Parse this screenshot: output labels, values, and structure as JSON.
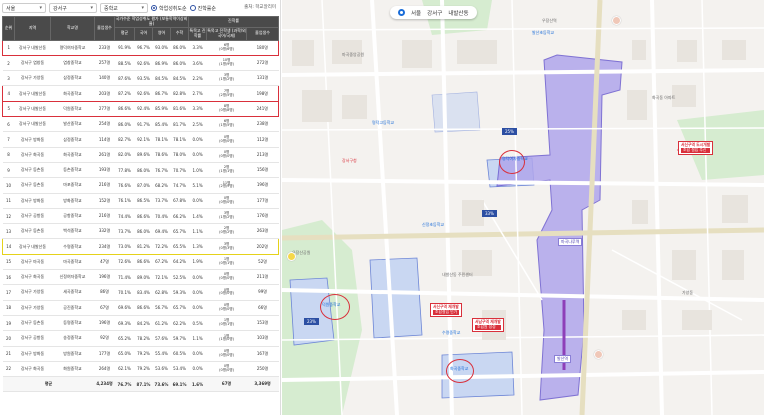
{
  "filters": {
    "region": "서울",
    "district": "강서구",
    "school_type": "중학교",
    "radio_1": "학업성취도순",
    "radio_2": "진학률순",
    "source": "출처: 학교알리미"
  },
  "table": {
    "headers": {
      "rank": "순위",
      "area": "지역",
      "school": "학교명",
      "students": "졸업생수",
      "group_top": "국가수준 학업성취도 평가 (보통학력이상비율)",
      "avg": "평균",
      "korean": "국어",
      "english": "영어",
      "math": "수학",
      "group_adv": "진학률",
      "sci": "특목고 진학률",
      "rate_sub": "특목고 진학생 (과학/외국어/국제)",
      "total": "졸업생수"
    },
    "rows": [
      {
        "rank": "1",
        "area": "강서구 내발산동",
        "school": "명덕여자중학교",
        "students": "233명",
        "avg": "91.9%",
        "kor": "96.7%",
        "eng": "93.0%",
        "math": "86.0%",
        "rate": "3.3%",
        "adv": "6명",
        "adv_sub": "(0명/6명)",
        "total": "180명",
        "hl": "red"
      },
      {
        "rank": "2",
        "area": "강서구 염창동",
        "school": "염창중학교",
        "students": "257명",
        "avg": "88.5%",
        "kor": "92.6%",
        "eng": "86.9%",
        "math": "86.0%",
        "rate": "3.6%",
        "adv": "10명",
        "adv_sub": "(1명/9명)",
        "total": "272명",
        "hl": ""
      },
      {
        "rank": "3",
        "area": "강서구 가양동",
        "school": "삼정중학교",
        "students": "140명",
        "avg": "87.6%",
        "kor": "93.5%",
        "eng": "84.5%",
        "math": "84.5%",
        "rate": "2.2%",
        "adv": "3명",
        "adv_sub": "(1명/2명)",
        "total": "131명",
        "hl": ""
      },
      {
        "rank": "4",
        "area": "강서구 내발산동",
        "school": "화곡중학교",
        "students": "203명",
        "avg": "87.2%",
        "kor": "92.6%",
        "eng": "86.7%",
        "math": "82.8%",
        "rate": "2.7%",
        "adv": "7명",
        "adv_sub": "(2명/5명)",
        "total": "198명",
        "hl": "red"
      },
      {
        "rank": "5",
        "area": "강서구 내발산동",
        "school": "덕원중학교",
        "students": "277명",
        "avg": "86.6%",
        "kor": "92.4%",
        "eng": "85.9%",
        "math": "81.6%",
        "rate": "3.3%",
        "adv": "8명",
        "adv_sub": "(0명/8명)",
        "total": "241명",
        "hl": "red"
      },
      {
        "rank": "6",
        "area": "강서구 내발산동",
        "school": "발산중학교",
        "students": "254명",
        "avg": "86.0%",
        "kor": "91.7%",
        "eng": "85.4%",
        "math": "81.7%",
        "rate": "2.5%",
        "adv": "6명",
        "adv_sub": "(1명/5명)",
        "total": "238명",
        "hl": ""
      },
      {
        "rank": "7",
        "area": "강서구 방화동",
        "school": "삼정중학교",
        "students": "114명",
        "avg": "82.7%",
        "kor": "92.1%",
        "eng": "78.1%",
        "math": "78.1%",
        "rate": "0.0%",
        "adv": "0명",
        "adv_sub": "(0명/0명)",
        "total": "112명",
        "hl": ""
      },
      {
        "rank": "8",
        "area": "강서구 화곡동",
        "school": "화곡중학교",
        "students": "261명",
        "avg": "82.0%",
        "kor": "89.6%",
        "eng": "78.6%",
        "math": "78.0%",
        "rate": "0.0%",
        "adv": "0명",
        "adv_sub": "(0명/0명)",
        "total": "213명",
        "hl": ""
      },
      {
        "rank": "9",
        "area": "강서구 등촌동",
        "school": "등촌중학교",
        "students": "193명",
        "avg": "77.8%",
        "kor": "86.0%",
        "eng": "76.7%",
        "math": "70.7%",
        "rate": "1.0%",
        "adv": "2명",
        "adv_sub": "(1명/1명)",
        "total": "156명",
        "hl": ""
      },
      {
        "rank": "10",
        "area": "강서구 등촌동",
        "school": "마포중학교",
        "students": "216명",
        "avg": "76.6%",
        "kor": "87.0%",
        "eng": "68.2%",
        "math": "74.7%",
        "rate": "5.1%",
        "adv": "11명",
        "adv_sub": "(2명/9명)",
        "total": "196명",
        "hl": ""
      },
      {
        "rank": "11",
        "area": "강서구 방화동",
        "school": "방화중학교",
        "students": "152명",
        "avg": "76.1%",
        "kor": "86.5%",
        "eng": "73.7%",
        "math": "67.8%",
        "rate": "0.0%",
        "adv": "0명",
        "adv_sub": "(0명/0명)",
        "total": "177명",
        "hl": ""
      },
      {
        "rank": "12",
        "area": "강서구 공항동",
        "school": "공항중학교",
        "students": "216명",
        "avg": "74.4%",
        "kor": "86.6%",
        "eng": "70.4%",
        "math": "66.2%",
        "rate": "1.4%",
        "adv": "3명",
        "adv_sub": "(1명/2명)",
        "total": "176명",
        "hl": ""
      },
      {
        "rank": "13",
        "area": "강서구 등촌동",
        "school": "백석중학교",
        "students": "332명",
        "avg": "73.7%",
        "kor": "86.0%",
        "eng": "69.4%",
        "math": "65.7%",
        "rate": "1.1%",
        "adv": "2명",
        "adv_sub": "(0명/2명)",
        "total": "263명",
        "hl": ""
      },
      {
        "rank": "14",
        "area": "강서구 내발산동",
        "school": "수명중학교",
        "students": "234명",
        "avg": "73.0%",
        "kor": "81.2%",
        "eng": "72.2%",
        "math": "65.5%",
        "rate": "1.3%",
        "adv": "3명",
        "adv_sub": "(0명/3명)",
        "total": "202명",
        "hl": "yellow"
      },
      {
        "rank": "15",
        "area": "강서구 마곡동",
        "school": "마곡중학교",
        "students": "47명",
        "avg": "72.6%",
        "kor": "86.6%",
        "eng": "67.2%",
        "math": "64.2%",
        "rate": "1.9%",
        "adv": "1명",
        "adv_sub": "(0명/1명)",
        "total": "52명",
        "hl": ""
      },
      {
        "rank": "16",
        "area": "강서구 화곡동",
        "school": "신정여자중학교",
        "students": "196명",
        "avg": "71.4%",
        "kor": "89.0%",
        "eng": "72.1%",
        "math": "52.5%",
        "rate": "0.0%",
        "adv": "0명",
        "adv_sub": "(0명/0명)",
        "total": "211명",
        "hl": ""
      },
      {
        "rank": "17",
        "area": "강서구 가양동",
        "school": "세곡중학교",
        "students": "86명",
        "avg": "70.1%",
        "kor": "83.4%",
        "eng": "62.8%",
        "math": "59.3%",
        "rate": "0.0%",
        "adv": "0명",
        "adv_sub": "(0명/0명)",
        "total": "99명",
        "hl": ""
      },
      {
        "rank": "18",
        "area": "강서구 가양동",
        "school": "공진중학교",
        "students": "67명",
        "avg": "69.6%",
        "kor": "86.6%",
        "eng": "56.7%",
        "math": "65.7%",
        "rate": "0.0%",
        "adv": "0명",
        "adv_sub": "(0명/0명)",
        "total": "66명",
        "hl": ""
      },
      {
        "rank": "19",
        "area": "강서구 등촌동",
        "school": "등명중학교",
        "students": "196명",
        "avg": "69.3%",
        "kor": "84.2%",
        "eng": "61.2%",
        "math": "62.2%",
        "rate": "0.5%",
        "adv": "1명",
        "adv_sub": "(0명/1명)",
        "total": "153명",
        "hl": ""
      },
      {
        "rank": "20",
        "area": "강서구 공항동",
        "school": "송정중학교",
        "students": "92명",
        "avg": "65.2%",
        "kor": "78.2%",
        "eng": "57.6%",
        "math": "59.7%",
        "rate": "1.1%",
        "adv": "1명",
        "adv_sub": "(1명/0명)",
        "total": "103명",
        "hl": ""
      },
      {
        "rank": "21",
        "area": "강서구 방화동",
        "school": "방원중학교",
        "students": "177명",
        "avg": "65.0%",
        "kor": "79.2%",
        "eng": "55.4%",
        "math": "60.5%",
        "rate": "0.0%",
        "adv": "0명",
        "adv_sub": "(0명/0명)",
        "total": "167명",
        "hl": ""
      },
      {
        "rank": "22",
        "area": "강서구 화곡동",
        "school": "화원중학교",
        "students": "264명",
        "avg": "62.1%",
        "kor": "79.2%",
        "eng": "53.6%",
        "math": "53.4%",
        "rate": "0.0%",
        "adv": "0명",
        "adv_sub": "(0명/0명)",
        "total": "250명",
        "hl": ""
      }
    ],
    "average": {
      "label": "평균",
      "students": "4,234명",
      "avg": "76.7%",
      "kor": "87.1%",
      "eng": "73.6%",
      "math": "69.1%",
      "rate": "1.6%",
      "adv": "67명",
      "total": "3,369명"
    }
  },
  "map": {
    "crumb": [
      "서울",
      "강서구",
      "내발산동"
    ],
    "labels": {
      "school_a": "명덕여자중학교",
      "school_b": "덕원중학교",
      "school_c": "화곡중학교",
      "school_d": "수명중학교",
      "pct_a": "25%",
      "pct_b": "23%",
      "pct_c": "33%",
      "badge1_t": "서신구역 도시개발",
      "badge1_b": "조합 설립 추진",
      "badge2_t": "서신구역 재개발",
      "badge2_b": "조합설립 인가",
      "badge3_t": "서남구역 재개발",
      "badge3_b": "조합원 정정",
      "station1": "마곡나루역",
      "station2": "발산역",
      "poi_1": "우장산역",
      "poi_2": "마곡중앙공원",
      "poi_3": "발산초등학교",
      "poi_4": "화곡동 아파트",
      "poi_5": "우장산공원",
      "poi_6": "강서구청",
      "poi_7": "내발산동 주민센터",
      "poi_8": "신정초등학교",
      "poi_9": "명덕고등학교",
      "poi_10": "가양동"
    }
  }
}
